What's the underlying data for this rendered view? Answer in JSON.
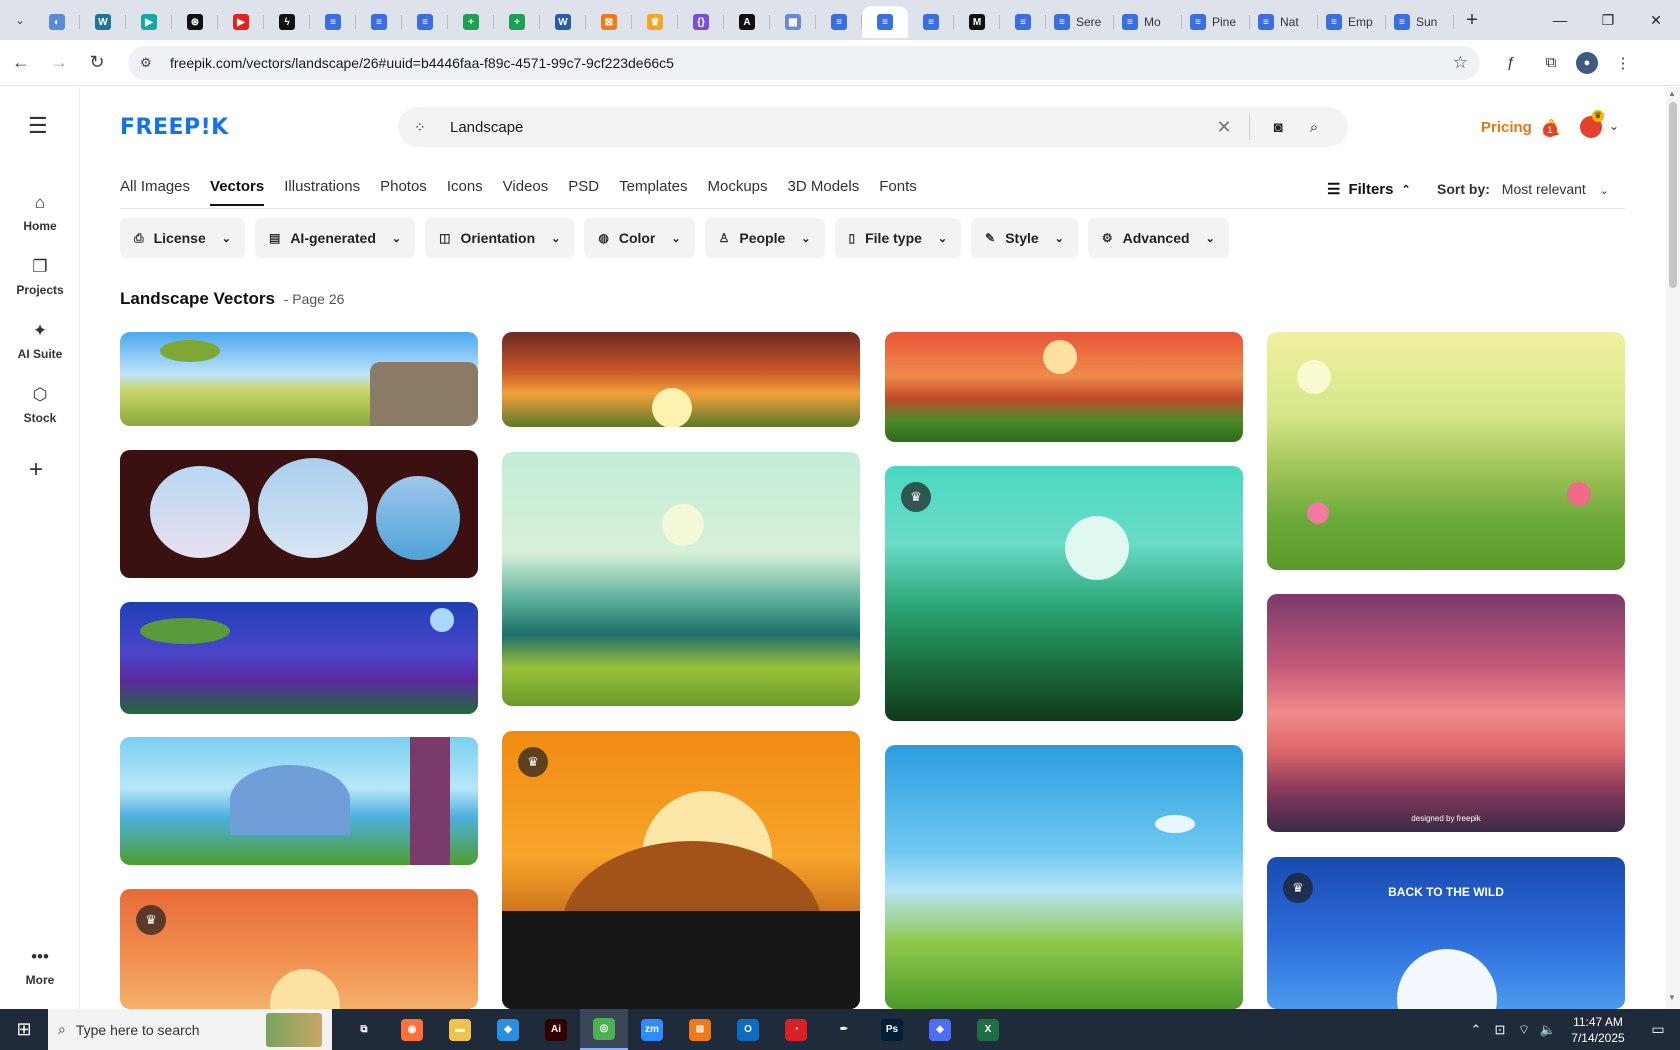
{
  "browser": {
    "tabs": [
      {
        "type": "pinned",
        "fav": "globe",
        "color": "#5a8bd6",
        "glyph": "◐"
      },
      {
        "type": "pinned",
        "fav": "wp",
        "color": "#21759b",
        "glyph": "W"
      },
      {
        "type": "pinned",
        "fav": "arrow",
        "color": "#13a8a8",
        "glyph": "▶"
      },
      {
        "type": "pinned",
        "fav": "openai",
        "color": "#111111",
        "glyph": "⊛"
      },
      {
        "type": "pinned",
        "fav": "youtube",
        "color": "#e62117",
        "glyph": "▶"
      },
      {
        "type": "pinned",
        "fav": "bolt",
        "color": "#111111",
        "glyph": "ϟ"
      },
      {
        "type": "pinned",
        "fav": "doc",
        "color": "#3b6fe0",
        "glyph": "≡"
      },
      {
        "type": "pinned",
        "fav": "doc",
        "color": "#3b6fe0",
        "glyph": "≡"
      },
      {
        "type": "pinned",
        "fav": "doc",
        "color": "#3b6fe0",
        "glyph": "≡"
      },
      {
        "type": "pinned",
        "fav": "sheet",
        "color": "#1e9f54",
        "glyph": "+"
      },
      {
        "type": "pinned",
        "fav": "sheet",
        "color": "#1e9f54",
        "glyph": "+"
      },
      {
        "type": "pinned",
        "fav": "word",
        "color": "#2a5caa",
        "glyph": "W"
      },
      {
        "type": "pinned",
        "fav": "xampp",
        "color": "#f07b16",
        "glyph": "⊠"
      },
      {
        "type": "pinned",
        "fav": "crown",
        "color": "#f5a623",
        "glyph": "♛"
      },
      {
        "type": "pinned",
        "fav": "braces",
        "color": "#7a4fd3",
        "glyph": "{}"
      },
      {
        "type": "pinned",
        "fav": "a",
        "color": "#111111",
        "glyph": "A"
      },
      {
        "type": "pinned",
        "fav": "grid",
        "color": "#6a8ad4",
        "glyph": "▦"
      },
      {
        "type": "pinned",
        "fav": "doc",
        "color": "#3b6fe0",
        "glyph": "≡"
      },
      {
        "type": "pinned",
        "fav": "doc",
        "color": "#3b6fe0",
        "glyph": "≡",
        "active": true
      },
      {
        "type": "pinned",
        "fav": "doc",
        "color": "#3b6fe0",
        "glyph": "≡"
      },
      {
        "type": "pinned",
        "fav": "m",
        "color": "#111111",
        "glyph": "M"
      },
      {
        "type": "pinned",
        "fav": "doc",
        "color": "#3b6fe0",
        "glyph": "≡"
      },
      {
        "type": "titled",
        "fav": "doc",
        "color": "#3b6fe0",
        "glyph": "≡",
        "title": "Sere"
      },
      {
        "type": "titled",
        "fav": "doc",
        "color": "#3b6fe0",
        "glyph": "≡",
        "title": "Mo"
      },
      {
        "type": "titled",
        "fav": "doc",
        "color": "#3b6fe0",
        "glyph": "≡",
        "title": "Pine"
      },
      {
        "type": "titled",
        "fav": "doc",
        "color": "#3b6fe0",
        "glyph": "≡",
        "title": "Nat"
      },
      {
        "type": "titled",
        "fav": "doc",
        "color": "#3b6fe0",
        "glyph": "≡",
        "title": "Emp"
      },
      {
        "type": "titled",
        "fav": "doc",
        "color": "#3b6fe0",
        "glyph": "≡",
        "title": "Sun"
      }
    ],
    "url": "freepik.com/vectors/landscape/26#uuid=b4446faa-f89c-4571-99c7-9cf223de66c5"
  },
  "sidebar": {
    "items": [
      {
        "label": "Home",
        "icon": "⌂"
      },
      {
        "label": "Projects",
        "icon": "❐"
      },
      {
        "label": "AI Suite",
        "icon": "✦"
      },
      {
        "label": "Stock",
        "icon": "⬡"
      }
    ],
    "more_label": "More"
  },
  "header": {
    "logo": "FREEP!K",
    "search_value": "Landscape",
    "pricing": "Pricing",
    "notifications": "1"
  },
  "categories": [
    "All Images",
    "Vectors",
    "Illustrations",
    "Photos",
    "Icons",
    "Videos",
    "PSD",
    "Templates",
    "Mockups",
    "3D Models",
    "Fonts"
  ],
  "active_category": "Vectors",
  "filters_label": "Filters",
  "sort": {
    "label": "Sort by:",
    "value": "Most relevant"
  },
  "chips": [
    {
      "label": "License",
      "icon": "⎙"
    },
    {
      "label": "AI-generated",
      "icon": "▤"
    },
    {
      "label": "Orientation",
      "icon": "◫"
    },
    {
      "label": "Color",
      "icon": "◍"
    },
    {
      "label": "People",
      "icon": "♙"
    },
    {
      "label": "File type",
      "icon": "▯"
    },
    {
      "label": "Style",
      "icon": "✎"
    },
    {
      "label": "Advanced",
      "icon": "⚙"
    }
  ],
  "heading": {
    "title": "Landscape Vectors",
    "page": "- Page 26"
  },
  "cards": {
    "c8_caption": "designed by freepik",
    "c12_title": "BACK TO THE WILD"
  },
  "taskbar": {
    "search_placeholder": "Type here to search",
    "time": "11:47 AM",
    "date": "7/14/2025",
    "apps": [
      {
        "name": "task-view",
        "glyph": "⧉",
        "color": "#1f2a3a"
      },
      {
        "name": "firefox",
        "glyph": "◉",
        "color": "#ff7139"
      },
      {
        "name": "file-explorer",
        "glyph": "▬",
        "color": "#f2c14e"
      },
      {
        "name": "vscode",
        "glyph": "◆",
        "color": "#2b8fe0"
      },
      {
        "name": "illustrator",
        "glyph": "Ai",
        "color": "#330000"
      },
      {
        "name": "chrome",
        "glyph": "◎",
        "color": "#4caf50",
        "active": true
      },
      {
        "name": "zoom",
        "glyph": "zm",
        "color": "#2d8cff"
      },
      {
        "name": "xampp",
        "glyph": "⊠",
        "color": "#f07b16"
      },
      {
        "name": "outlook",
        "glyph": "O",
        "color": "#0f6cbd"
      },
      {
        "name": "creative-cloud",
        "glyph": "◔",
        "color": "#da1f26"
      },
      {
        "name": "pen-tool",
        "glyph": "✒",
        "color": "#1f2a3a"
      },
      {
        "name": "photoshop",
        "glyph": "Ps",
        "color": "#001e36"
      },
      {
        "name": "diamond-app",
        "glyph": "◈",
        "color": "#4c6ef5"
      },
      {
        "name": "excel",
        "glyph": "X",
        "color": "#1d6f42"
      }
    ]
  }
}
